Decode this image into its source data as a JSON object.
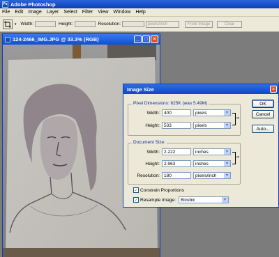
{
  "app": {
    "title": "Adobe Photoshop",
    "logo_text": "Ps"
  },
  "menu": [
    "File",
    "Edit",
    "Image",
    "Layer",
    "Select",
    "Filter",
    "View",
    "Window",
    "Help"
  ],
  "options": {
    "width_label": "Width:",
    "height_label": "Height:",
    "resolution_label": "Resolution:",
    "resolution_unit": "pixels/inch",
    "front_image_label": "Front Image",
    "clear_label": "Clear"
  },
  "document": {
    "title": "124-2466_IMG.JPG @ 33.3% (RGB)"
  },
  "dialog": {
    "title": "Image Size",
    "pixel_dimensions": {
      "title": "Pixel Dimensions: 625K (was 5.49M)",
      "width_label": "Width:",
      "width_value": "400",
      "width_unit": "pixels",
      "height_label": "Height:",
      "height_value": "533",
      "height_unit": "pixels"
    },
    "document_size": {
      "title": "Document Size:",
      "width_label": "Width:",
      "width_value": "2.222",
      "width_unit": "inches",
      "height_label": "Height:",
      "height_value": "2.963",
      "height_unit": "inches",
      "resolution_label": "Resolution:",
      "resolution_value": "180",
      "resolution_unit": "pixels/inch"
    },
    "constrain_label": "Constrain Proportions",
    "constrain_checked": true,
    "resample_label": "Resample Image:",
    "resample_checked": true,
    "resample_method": "Bicubic",
    "buttons": {
      "ok": "OK",
      "cancel": "Cancel",
      "auto": "Auto..."
    }
  },
  "colors": {
    "titlebar": "#0a3fb8",
    "dialog_bg": "#ece9d8",
    "group_title": "#0a2c9e"
  }
}
